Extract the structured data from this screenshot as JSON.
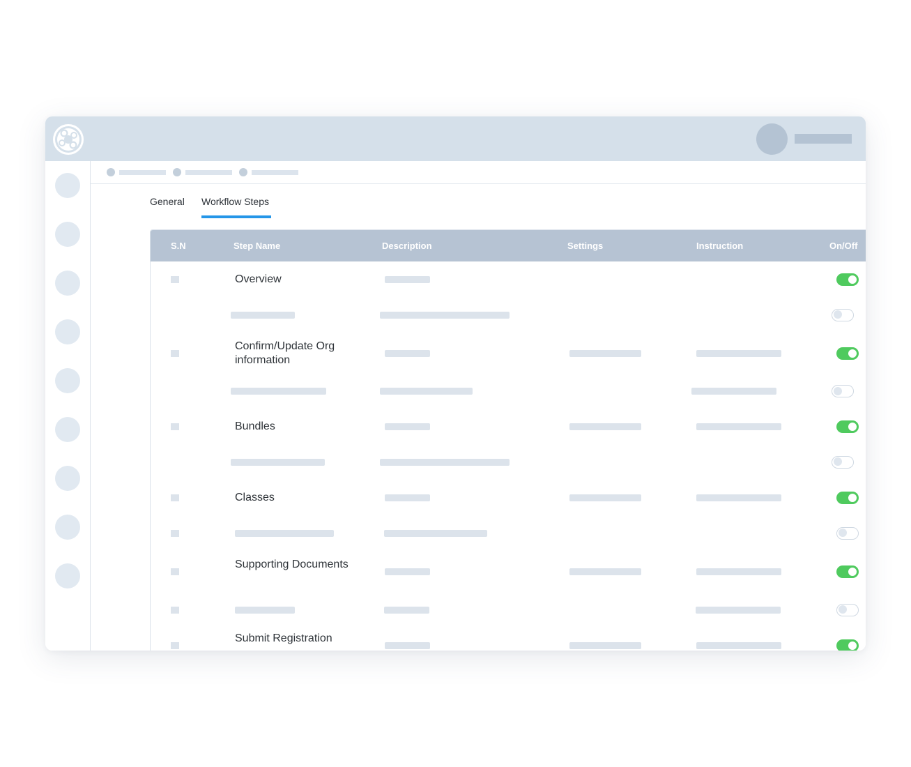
{
  "app": {
    "logo_icon": "app-logo-icon",
    "accent_color": "#2596e8",
    "toggle_on_color": "#4fca5e"
  },
  "sidebar": {
    "items": [
      {
        "icon": "nav-icon-1"
      },
      {
        "icon": "nav-icon-2"
      },
      {
        "icon": "nav-icon-3"
      },
      {
        "icon": "nav-icon-4"
      },
      {
        "icon": "nav-icon-5"
      },
      {
        "icon": "nav-icon-6"
      },
      {
        "icon": "nav-icon-7"
      },
      {
        "icon": "nav-icon-8"
      },
      {
        "icon": "nav-icon-9"
      }
    ]
  },
  "tabs": [
    {
      "label": "General",
      "active": false
    },
    {
      "label": "Workflow Steps",
      "active": true
    }
  ],
  "table": {
    "headers": {
      "sn": "S.N",
      "step_name": "Step Name",
      "description": "Description",
      "settings": "Settings",
      "instruction": "Instruction",
      "on_off": "On/Off"
    },
    "rows": [
      {
        "name": "Overview",
        "enabled": true
      },
      {
        "name": "",
        "enabled": false
      },
      {
        "name": "Confirm/Update Org information",
        "enabled": true
      },
      {
        "name": "",
        "enabled": false
      },
      {
        "name": "Bundles",
        "enabled": true
      },
      {
        "name": "",
        "enabled": false
      },
      {
        "name": "Classes",
        "enabled": true
      },
      {
        "name": "",
        "enabled": false
      },
      {
        "name": "Supporting Documents",
        "enabled": true
      },
      {
        "name": "",
        "enabled": false
      },
      {
        "name": "Submit Registration",
        "enabled": true
      }
    ]
  }
}
